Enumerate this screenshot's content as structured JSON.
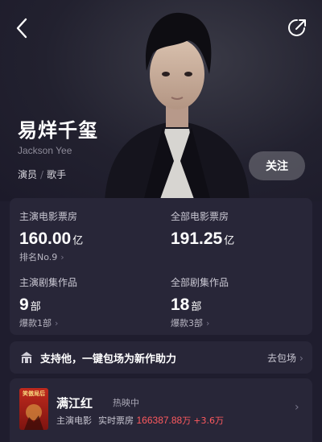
{
  "profile": {
    "name": "易烊千玺",
    "name_en": "Jackson Yee",
    "roles": [
      "演员",
      "歌手"
    ],
    "follow_label": "关注"
  },
  "stats": [
    {
      "label": "主演电影票房",
      "value": "160.00",
      "unit": "亿",
      "sub": "排名No.9",
      "sub_has_chevron": true
    },
    {
      "label": "全部电影票房",
      "value": "191.25",
      "unit": "亿",
      "sub": ""
    },
    {
      "label": "主演剧集作品",
      "value": "9",
      "unit": "部",
      "sub": "爆款1部",
      "sub_has_chevron": true
    },
    {
      "label": "全部剧集作品",
      "value": "18",
      "unit": "部",
      "sub": "爆款3部",
      "sub_has_chevron": true
    }
  ],
  "promo": {
    "text": "支持他，一键包场为新作助力",
    "link": "去包场"
  },
  "movie": {
    "poster_text": "笑傲局后",
    "title": "满江红",
    "status": "热映中",
    "role": "主演电影",
    "gross_label": "实时票房",
    "gross_value": "166387.88",
    "gross_unit": "万",
    "delta": "+3.6万"
  },
  "icons": {
    "back": "chevron-left-icon",
    "share": "share-icon",
    "promo": "cinema-building-icon"
  },
  "colors": {
    "background": "#1f1d2e",
    "card": "#282638",
    "accent_red": "#ff5a5f"
  }
}
